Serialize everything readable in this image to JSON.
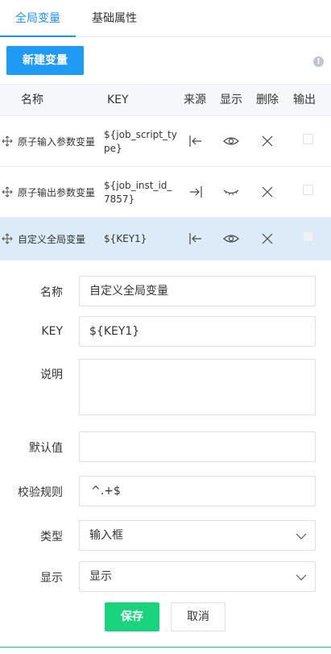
{
  "tabs": [
    {
      "label": "全局变量",
      "active": true
    },
    {
      "label": "基础属性",
      "active": false
    }
  ],
  "toolbar": {
    "new_button": "新建变量",
    "info_icon": "info-circle-icon"
  },
  "table": {
    "headers": [
      "名称",
      "KEY",
      "来源",
      "显示",
      "删除",
      "输出"
    ],
    "rows": [
      {
        "name": "原子输入参数变量",
        "key": "${job_script_type}",
        "source_icon": "import-icon",
        "visible_icon": "eye-open-icon",
        "selected": false
      },
      {
        "name": "原子输出参数变量",
        "key": "${job_inst_id_7857}",
        "source_icon": "export-icon",
        "visible_icon": "eye-closed-icon",
        "selected": false
      },
      {
        "name": "自定义全局变量",
        "key": "${KEY1}",
        "source_icon": "import-icon",
        "visible_icon": "eye-open-icon",
        "selected": true
      }
    ]
  },
  "form": {
    "name_label": "名称",
    "name_value": "自定义全局变量",
    "key_label": "KEY",
    "key_value": "${KEY1}",
    "desc_label": "说明",
    "desc_value": "",
    "default_label": "默认值",
    "default_value": "",
    "rule_label": "校验规则",
    "rule_value": "^.+$",
    "type_label": "类型",
    "type_value": "输入框",
    "display_label": "显示",
    "display_value": "显示",
    "save": "保存",
    "cancel": "取消"
  },
  "colors": {
    "primary": "#1f9bf5",
    "save": "#19d47c",
    "selected_row": "#dcebf7",
    "tab_active": "#1f8fff"
  }
}
